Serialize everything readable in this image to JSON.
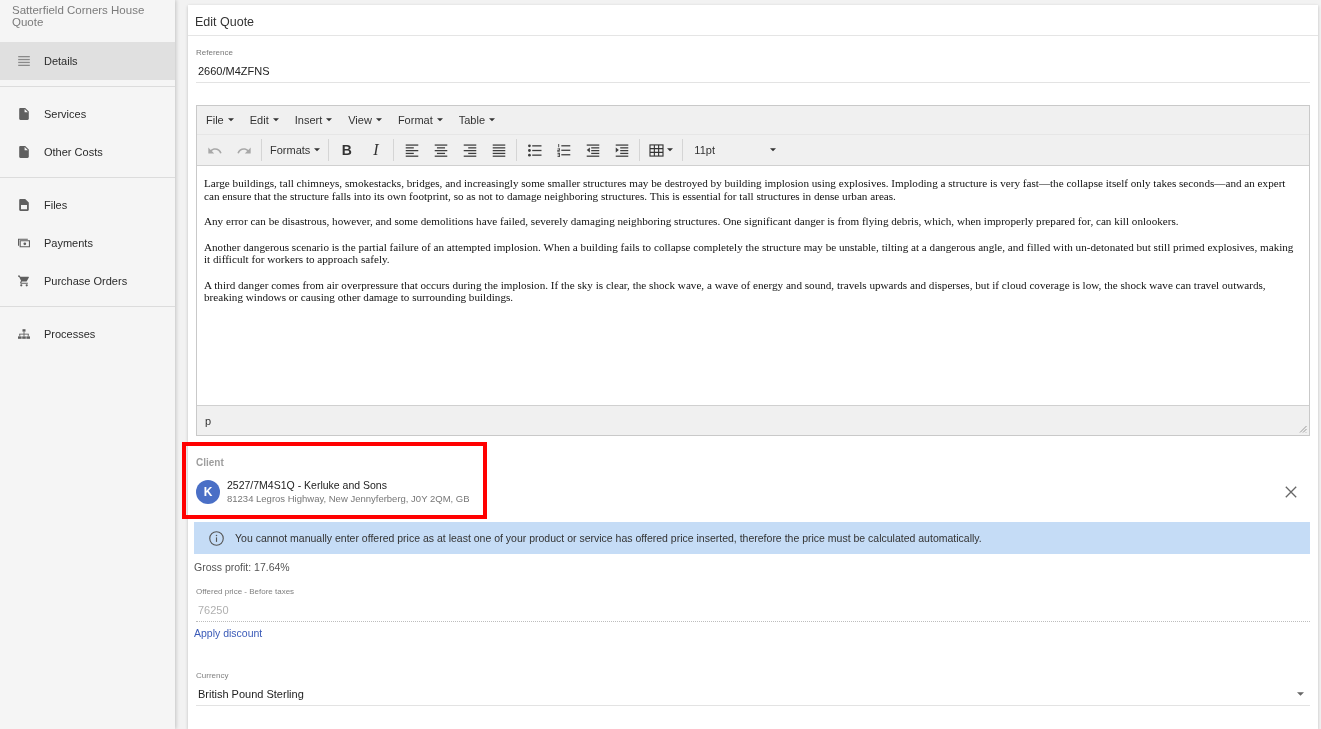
{
  "sidebar": {
    "title": "Satterfield Corners House Quote",
    "groups": [
      {
        "items": [
          {
            "label": "Details",
            "selected": true
          }
        ]
      },
      {
        "items": [
          {
            "label": "Services",
            "selected": false
          },
          {
            "label": "Other Costs",
            "selected": false
          }
        ]
      },
      {
        "items": [
          {
            "label": "Files",
            "selected": false
          },
          {
            "label": "Payments",
            "selected": false
          },
          {
            "label": "Purchase Orders",
            "selected": false
          }
        ]
      },
      {
        "items": [
          {
            "label": "Processes",
            "selected": false
          }
        ]
      }
    ]
  },
  "card": {
    "title": "Edit Quote"
  },
  "reference": {
    "label": "Reference",
    "value": "2660/M4ZFNS"
  },
  "editor": {
    "menus": [
      "File",
      "Edit",
      "Insert",
      "View",
      "Format",
      "Table"
    ],
    "toolbar": [
      {
        "buttons": [
          {
            "kind": "undo",
            "disabled": true
          },
          {
            "kind": "redo",
            "disabled": true
          }
        ]
      },
      {
        "buttons": [
          {
            "kind": "dropdown",
            "label": "Formats",
            "disabled": false
          }
        ]
      },
      {
        "buttons": [
          {
            "kind": "bold",
            "label": "B",
            "disabled": false
          },
          {
            "kind": "italic",
            "label": "I",
            "disabled": false
          }
        ]
      },
      {
        "buttons": [
          {
            "kind": "align-left",
            "disabled": false
          },
          {
            "kind": "align-center",
            "disabled": false
          },
          {
            "kind": "align-right",
            "disabled": false
          },
          {
            "kind": "justify",
            "disabled": false
          }
        ]
      },
      {
        "buttons": [
          {
            "kind": "bullet-list",
            "disabled": false
          },
          {
            "kind": "numbered-list",
            "disabled": false
          },
          {
            "kind": "outdent",
            "disabled": false
          },
          {
            "kind": "indent",
            "disabled": false
          }
        ]
      },
      {
        "buttons": [
          {
            "kind": "table",
            "disabled": false
          }
        ]
      },
      {
        "buttons": [
          {
            "kind": "size-select",
            "label": "11pt",
            "disabled": false
          }
        ]
      }
    ],
    "paragraphs": [
      "Large buildings, tall chimneys, smokestacks, bridges, and increasingly some smaller structures may be destroyed by building implosion using explosives. Imploding a structure is very fast—the collapse itself only takes seconds—and an expert can ensure that the structure falls into its own footprint, so as not to damage neighboring structures. This is essential for tall structures in dense urban areas.",
      "Any error can be disastrous, however, and some demolitions have failed, severely damaging neighboring structures. One significant danger is from flying debris, which, when improperly prepared for, can kill onlookers.",
      "Another dangerous scenario is the partial failure of an attempted implosion. When a building fails to collapse completely the structure may be unstable, tilting at a dangerous angle, and filled with un-detonated but still primed explosives, making it difficult for workers to approach safely.",
      "A third danger comes from air overpressure that occurs during the implosion. If the sky is clear, the shock wave, a wave of energy and sound, travels upwards and disperses, but if cloud coverage is low, the shock wave can travel outwards, breaking windows or causing other damage to surrounding buildings."
    ],
    "status_path": "p"
  },
  "client": {
    "label": "Client",
    "avatar": "K",
    "name": "2527/7M4S1Q - Kerluke and Sons",
    "address": "81234 Legros Highway, New Jennyferberg, J0Y 2QM, GB",
    "highlighted": true
  },
  "notice": "You cannot manually enter offered price as at least one of your product or service has offered price inserted, therefore the price must be calculated automatically.",
  "gross_profit": "Gross profit: 17.64%",
  "offered_price": {
    "label": "Offered price - Before taxes",
    "value": "76250",
    "disabled": true
  },
  "apply_discount": "Apply discount",
  "currency": {
    "label": "Currency",
    "value": "British Pound Sterling"
  }
}
